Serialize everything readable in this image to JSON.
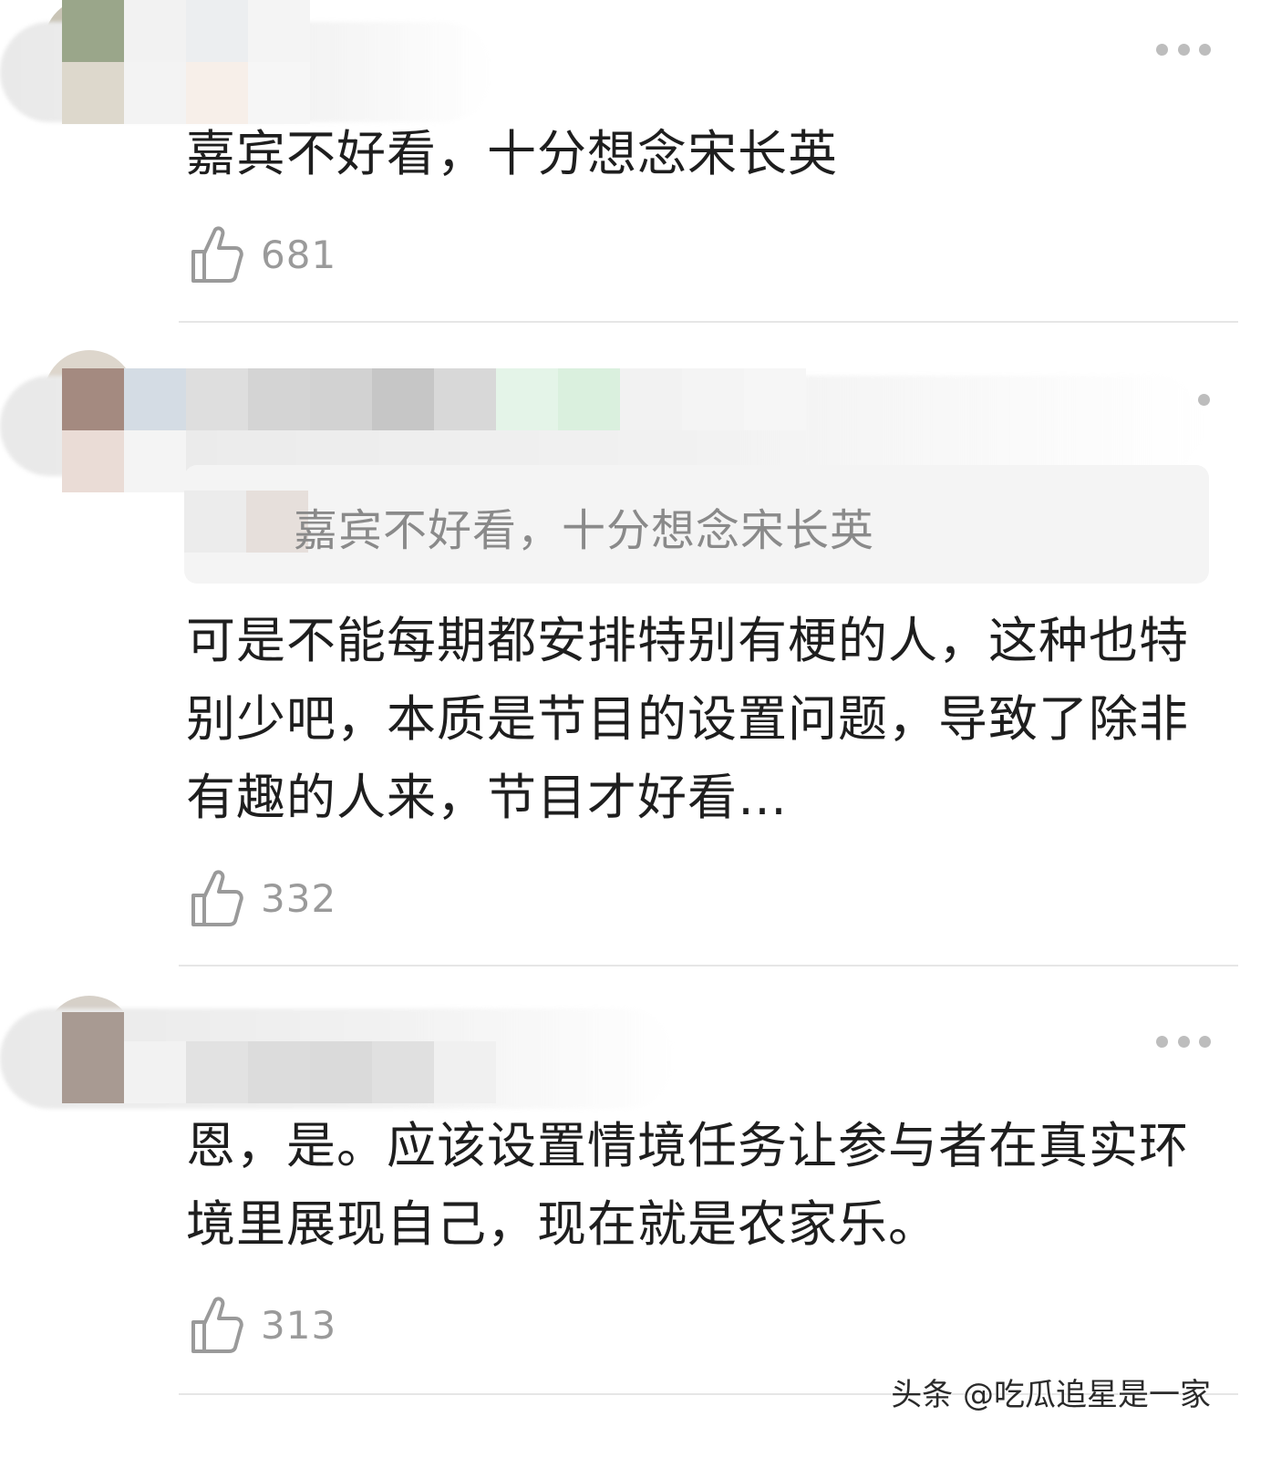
{
  "comments": [
    {
      "text": "嘉宾不好看，十分想念宋长英",
      "likes": "681"
    },
    {
      "quote": "嘉宾不好看，十分想念宋长英",
      "text": "可是不能每期都安排特别有梗的人，这种也特别少吧，本质是节目的设置问题，导致了除非有趣的人来，节目才好看…",
      "likes": "332"
    },
    {
      "text": "恩，是。应该设置情境任务让参与者在真实环境里展现自己，现在就是农家乐。",
      "likes": "313"
    }
  ],
  "watermark": "头条 @吃瓜追星是一家",
  "icons": {
    "like": "thumbs-up-icon",
    "more": "more-dots-icon"
  },
  "colors": {
    "text": "#1e1e1e",
    "muted": "#9a9a9a",
    "divider": "#e6e6e6",
    "quote_bg": "#f4f4f4"
  }
}
